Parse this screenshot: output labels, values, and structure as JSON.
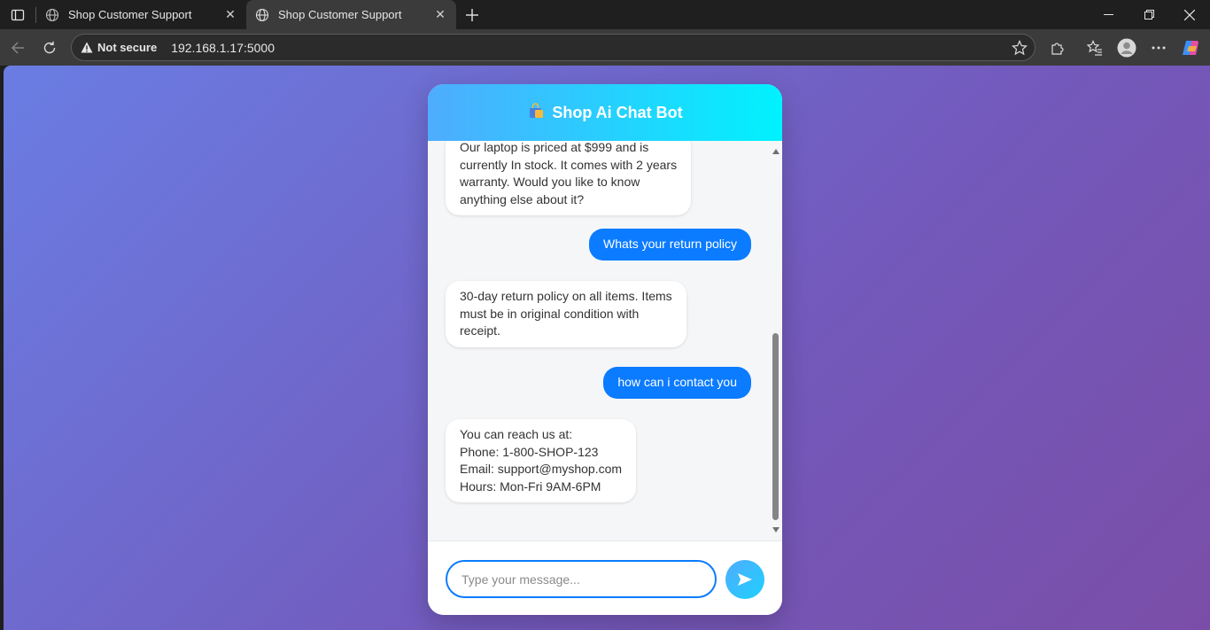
{
  "browser": {
    "tabs": [
      {
        "title": "Shop Customer Support",
        "active": false
      },
      {
        "title": "Shop Customer Support",
        "active": true
      }
    ],
    "address": {
      "security_label": "Not secure",
      "url": "192.168.1.17:5000"
    }
  },
  "chat": {
    "header": {
      "icon": "shopping-bag-icon",
      "title": "Shop Ai Chat Bot"
    },
    "messages": [
      {
        "role": "bot",
        "text": "Our laptop is priced at $999 and is\ncurrently In stock. It comes with 2 years\nwarranty. Would you like to know\nanything else about it?"
      },
      {
        "role": "user",
        "text": "Whats your return policy"
      },
      {
        "role": "bot",
        "text": "30-day return policy on all items. Items\nmust be in original condition with\nreceipt."
      },
      {
        "role": "user",
        "text": "how can i contact you"
      },
      {
        "role": "bot",
        "text": "You can reach us at:\nPhone: 1-800-SHOP-123\nEmail: support@myshop.com\nHours: Mon-Fri 9AM-6PM"
      }
    ],
    "input": {
      "placeholder": "Type your message...",
      "value": ""
    },
    "send_icon": "send-arrow-icon"
  },
  "colors": {
    "user_bubble": "#0b7bff",
    "header_gradient_start": "#4facfe",
    "header_gradient_end": "#00f2fe"
  }
}
